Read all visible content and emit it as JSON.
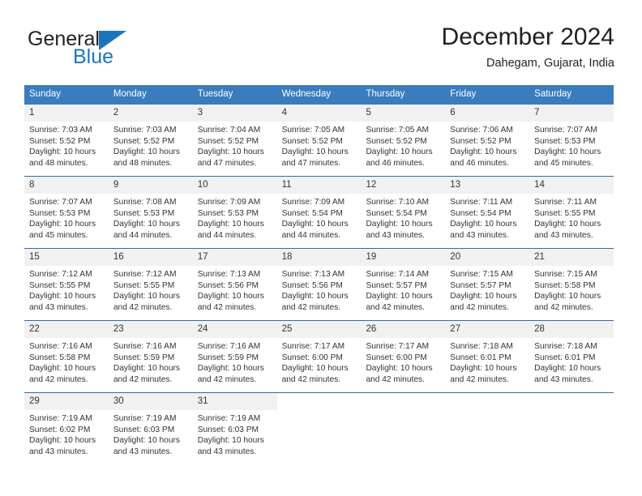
{
  "logo": {
    "word1": "General",
    "word2": "Blue",
    "triangle_color": "#1b75bb"
  },
  "header": {
    "title": "December 2024",
    "subtitle": "Dahegam, Gujarat, India"
  },
  "calendar": {
    "header_bg": "#3a7cbe",
    "weekdays": [
      "Sunday",
      "Monday",
      "Tuesday",
      "Wednesday",
      "Thursday",
      "Friday",
      "Saturday"
    ],
    "weeks": [
      [
        {
          "day": "1",
          "sunrise": "Sunrise: 7:03 AM",
          "sunset": "Sunset: 5:52 PM",
          "daylight1": "Daylight: 10 hours",
          "daylight2": "and 48 minutes."
        },
        {
          "day": "2",
          "sunrise": "Sunrise: 7:03 AM",
          "sunset": "Sunset: 5:52 PM",
          "daylight1": "Daylight: 10 hours",
          "daylight2": "and 48 minutes."
        },
        {
          "day": "3",
          "sunrise": "Sunrise: 7:04 AM",
          "sunset": "Sunset: 5:52 PM",
          "daylight1": "Daylight: 10 hours",
          "daylight2": "and 47 minutes."
        },
        {
          "day": "4",
          "sunrise": "Sunrise: 7:05 AM",
          "sunset": "Sunset: 5:52 PM",
          "daylight1": "Daylight: 10 hours",
          "daylight2": "and 47 minutes."
        },
        {
          "day": "5",
          "sunrise": "Sunrise: 7:05 AM",
          "sunset": "Sunset: 5:52 PM",
          "daylight1": "Daylight: 10 hours",
          "daylight2": "and 46 minutes."
        },
        {
          "day": "6",
          "sunrise": "Sunrise: 7:06 AM",
          "sunset": "Sunset: 5:52 PM",
          "daylight1": "Daylight: 10 hours",
          "daylight2": "and 46 minutes."
        },
        {
          "day": "7",
          "sunrise": "Sunrise: 7:07 AM",
          "sunset": "Sunset: 5:53 PM",
          "daylight1": "Daylight: 10 hours",
          "daylight2": "and 45 minutes."
        }
      ],
      [
        {
          "day": "8",
          "sunrise": "Sunrise: 7:07 AM",
          "sunset": "Sunset: 5:53 PM",
          "daylight1": "Daylight: 10 hours",
          "daylight2": "and 45 minutes."
        },
        {
          "day": "9",
          "sunrise": "Sunrise: 7:08 AM",
          "sunset": "Sunset: 5:53 PM",
          "daylight1": "Daylight: 10 hours",
          "daylight2": "and 44 minutes."
        },
        {
          "day": "10",
          "sunrise": "Sunrise: 7:09 AM",
          "sunset": "Sunset: 5:53 PM",
          "daylight1": "Daylight: 10 hours",
          "daylight2": "and 44 minutes."
        },
        {
          "day": "11",
          "sunrise": "Sunrise: 7:09 AM",
          "sunset": "Sunset: 5:54 PM",
          "daylight1": "Daylight: 10 hours",
          "daylight2": "and 44 minutes."
        },
        {
          "day": "12",
          "sunrise": "Sunrise: 7:10 AM",
          "sunset": "Sunset: 5:54 PM",
          "daylight1": "Daylight: 10 hours",
          "daylight2": "and 43 minutes."
        },
        {
          "day": "13",
          "sunrise": "Sunrise: 7:11 AM",
          "sunset": "Sunset: 5:54 PM",
          "daylight1": "Daylight: 10 hours",
          "daylight2": "and 43 minutes."
        },
        {
          "day": "14",
          "sunrise": "Sunrise: 7:11 AM",
          "sunset": "Sunset: 5:55 PM",
          "daylight1": "Daylight: 10 hours",
          "daylight2": "and 43 minutes."
        }
      ],
      [
        {
          "day": "15",
          "sunrise": "Sunrise: 7:12 AM",
          "sunset": "Sunset: 5:55 PM",
          "daylight1": "Daylight: 10 hours",
          "daylight2": "and 43 minutes."
        },
        {
          "day": "16",
          "sunrise": "Sunrise: 7:12 AM",
          "sunset": "Sunset: 5:55 PM",
          "daylight1": "Daylight: 10 hours",
          "daylight2": "and 42 minutes."
        },
        {
          "day": "17",
          "sunrise": "Sunrise: 7:13 AM",
          "sunset": "Sunset: 5:56 PM",
          "daylight1": "Daylight: 10 hours",
          "daylight2": "and 42 minutes."
        },
        {
          "day": "18",
          "sunrise": "Sunrise: 7:13 AM",
          "sunset": "Sunset: 5:56 PM",
          "daylight1": "Daylight: 10 hours",
          "daylight2": "and 42 minutes."
        },
        {
          "day": "19",
          "sunrise": "Sunrise: 7:14 AM",
          "sunset": "Sunset: 5:57 PM",
          "daylight1": "Daylight: 10 hours",
          "daylight2": "and 42 minutes."
        },
        {
          "day": "20",
          "sunrise": "Sunrise: 7:15 AM",
          "sunset": "Sunset: 5:57 PM",
          "daylight1": "Daylight: 10 hours",
          "daylight2": "and 42 minutes."
        },
        {
          "day": "21",
          "sunrise": "Sunrise: 7:15 AM",
          "sunset": "Sunset: 5:58 PM",
          "daylight1": "Daylight: 10 hours",
          "daylight2": "and 42 minutes."
        }
      ],
      [
        {
          "day": "22",
          "sunrise": "Sunrise: 7:16 AM",
          "sunset": "Sunset: 5:58 PM",
          "daylight1": "Daylight: 10 hours",
          "daylight2": "and 42 minutes."
        },
        {
          "day": "23",
          "sunrise": "Sunrise: 7:16 AM",
          "sunset": "Sunset: 5:59 PM",
          "daylight1": "Daylight: 10 hours",
          "daylight2": "and 42 minutes."
        },
        {
          "day": "24",
          "sunrise": "Sunrise: 7:16 AM",
          "sunset": "Sunset: 5:59 PM",
          "daylight1": "Daylight: 10 hours",
          "daylight2": "and 42 minutes."
        },
        {
          "day": "25",
          "sunrise": "Sunrise: 7:17 AM",
          "sunset": "Sunset: 6:00 PM",
          "daylight1": "Daylight: 10 hours",
          "daylight2": "and 42 minutes."
        },
        {
          "day": "26",
          "sunrise": "Sunrise: 7:17 AM",
          "sunset": "Sunset: 6:00 PM",
          "daylight1": "Daylight: 10 hours",
          "daylight2": "and 42 minutes."
        },
        {
          "day": "27",
          "sunrise": "Sunrise: 7:18 AM",
          "sunset": "Sunset: 6:01 PM",
          "daylight1": "Daylight: 10 hours",
          "daylight2": "and 42 minutes."
        },
        {
          "day": "28",
          "sunrise": "Sunrise: 7:18 AM",
          "sunset": "Sunset: 6:01 PM",
          "daylight1": "Daylight: 10 hours",
          "daylight2": "and 43 minutes."
        }
      ],
      [
        {
          "day": "29",
          "sunrise": "Sunrise: 7:19 AM",
          "sunset": "Sunset: 6:02 PM",
          "daylight1": "Daylight: 10 hours",
          "daylight2": "and 43 minutes."
        },
        {
          "day": "30",
          "sunrise": "Sunrise: 7:19 AM",
          "sunset": "Sunset: 6:03 PM",
          "daylight1": "Daylight: 10 hours",
          "daylight2": "and 43 minutes."
        },
        {
          "day": "31",
          "sunrise": "Sunrise: 7:19 AM",
          "sunset": "Sunset: 6:03 PM",
          "daylight1": "Daylight: 10 hours",
          "daylight2": "and 43 minutes."
        },
        {
          "day": "",
          "sunrise": "",
          "sunset": "",
          "daylight1": "",
          "daylight2": ""
        },
        {
          "day": "",
          "sunrise": "",
          "sunset": "",
          "daylight1": "",
          "daylight2": ""
        },
        {
          "day": "",
          "sunrise": "",
          "sunset": "",
          "daylight1": "",
          "daylight2": ""
        },
        {
          "day": "",
          "sunrise": "",
          "sunset": "",
          "daylight1": "",
          "daylight2": ""
        }
      ]
    ]
  }
}
